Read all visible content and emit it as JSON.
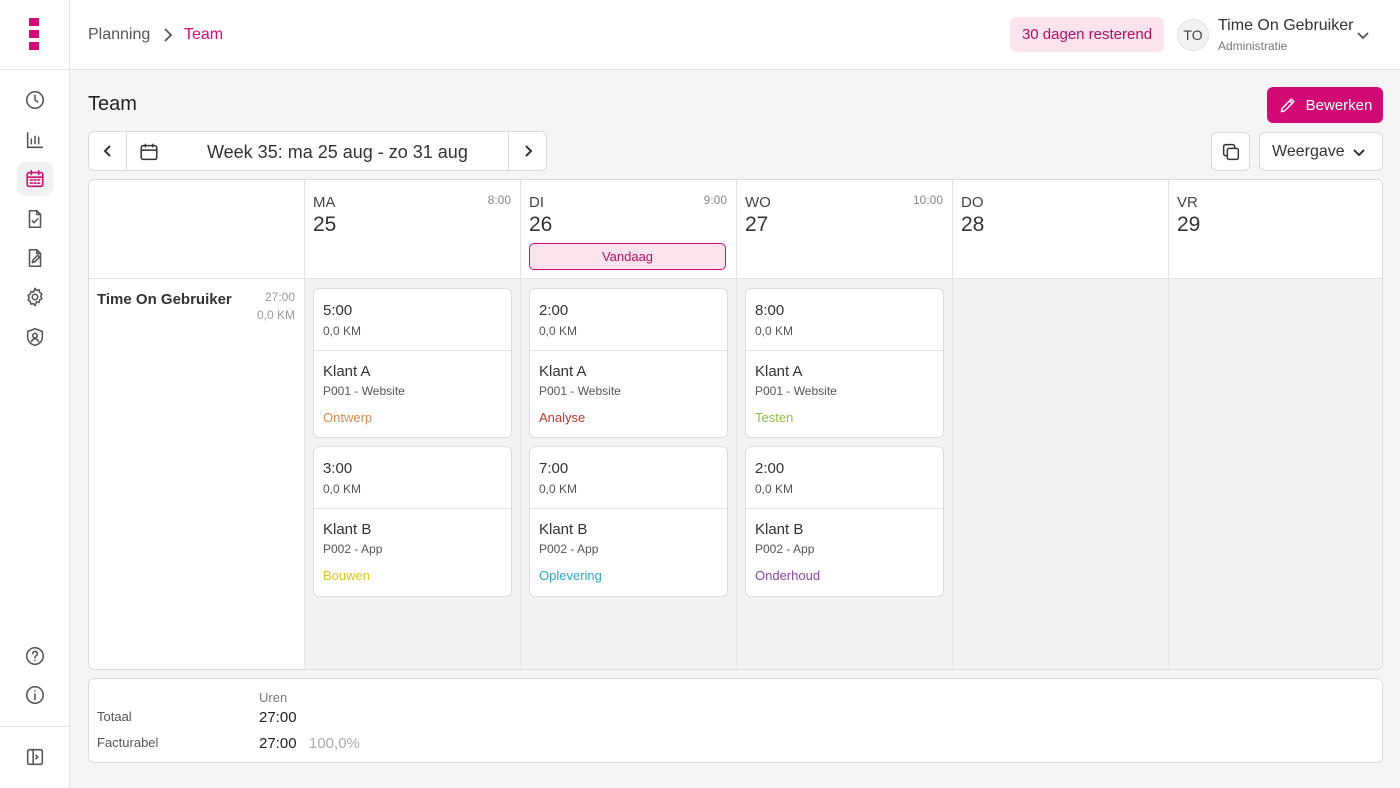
{
  "colors": {
    "accent": "#d10a75",
    "accent_soft": "#fbe3ee"
  },
  "header": {
    "breadcrumb": [
      "Planning",
      "Team"
    ],
    "trial": "30 dagen resterend",
    "user": {
      "initials": "TO",
      "name": "Time On Gebruiker",
      "role": "Administratie"
    }
  },
  "sidebar": {
    "items": [
      {
        "icon": "clock-icon"
      },
      {
        "icon": "chart-icon"
      },
      {
        "icon": "calendar-icon",
        "active": true
      },
      {
        "icon": "document-check-icon"
      },
      {
        "icon": "document-edit-icon"
      },
      {
        "icon": "gear-icon"
      },
      {
        "icon": "shield-user-icon"
      },
      {
        "icon": "help-icon"
      },
      {
        "icon": "info-icon"
      },
      {
        "icon": "sidebar-toggle-icon"
      }
    ]
  },
  "page": {
    "title": "Team",
    "edit_label": "Bewerken",
    "week_label": "Week 35: ma 25 aug - zo 31 aug",
    "view_label": "Weergave"
  },
  "days": [
    {
      "abbr": "MA",
      "num": "25",
      "hours": "8:00"
    },
    {
      "abbr": "DI",
      "num": "26",
      "hours": "9:00",
      "today": "Vandaag"
    },
    {
      "abbr": "WO",
      "num": "27",
      "hours": "10:00"
    },
    {
      "abbr": "DO",
      "num": "28",
      "hours": ""
    },
    {
      "abbr": "VR",
      "num": "29",
      "hours": ""
    }
  ],
  "row": {
    "name": "Time On Gebruiker",
    "hours": "27:00",
    "km": "0,0 KM"
  },
  "entries": [
    [
      {
        "hours": "5:00",
        "km": "0,0 KM",
        "client": "Klant A",
        "project": "P001 - Website",
        "task": "Ontwerp",
        "task_color": "#e0874a"
      },
      {
        "hours": "3:00",
        "km": "0,0 KM",
        "client": "Klant B",
        "project": "P002 - App",
        "task": "Bouwen",
        "task_color": "#e2c21b"
      }
    ],
    [
      {
        "hours": "2:00",
        "km": "0,0 KM",
        "client": "Klant A",
        "project": "P001 - Website",
        "task": "Analyse",
        "task_color": "#c0392b"
      },
      {
        "hours": "7:00",
        "km": "0,0 KM",
        "client": "Klant B",
        "project": "P002 - App",
        "task": "Oplevering",
        "task_color": "#2aa9c9"
      }
    ],
    [
      {
        "hours": "8:00",
        "km": "0,0 KM",
        "client": "Klant A",
        "project": "P001 - Website",
        "task": "Testen",
        "task_color": "#8bbf3f"
      },
      {
        "hours": "2:00",
        "km": "0,0 KM",
        "client": "Klant B",
        "project": "P002 - App",
        "task": "Onderhoud",
        "task_color": "#8e44ad"
      }
    ]
  ],
  "totals": {
    "col_header": "Uren",
    "total_label": "Totaal",
    "total_value": "27:00",
    "billable_label": "Facturabel",
    "billable_value": "27:00",
    "billable_pct": "100,0%"
  }
}
